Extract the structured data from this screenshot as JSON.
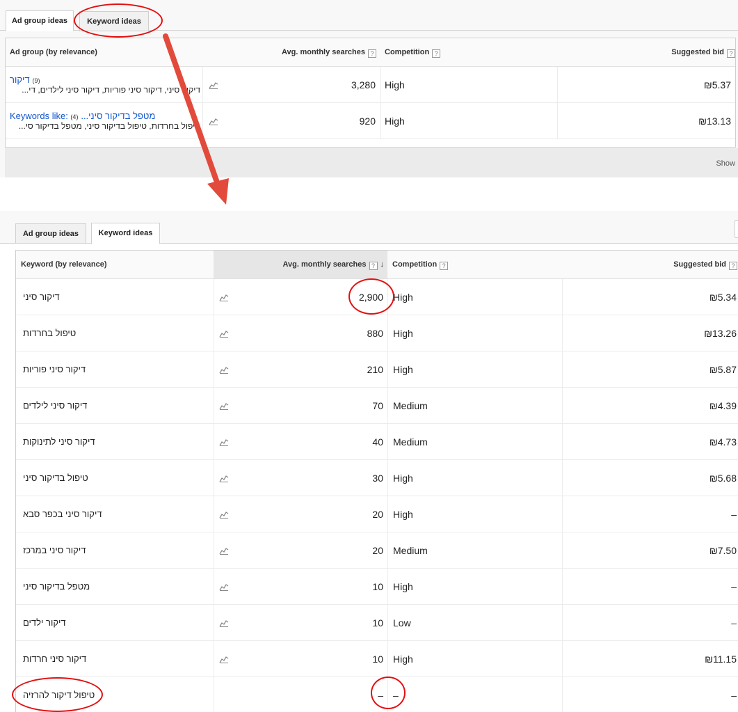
{
  "top_panel": {
    "tabs": [
      {
        "label": "Ad group ideas",
        "active": true
      },
      {
        "label": "Keyword ideas",
        "active": false
      }
    ],
    "columns": {
      "group": "Ad group (by relevance)",
      "searches": "Avg. monthly searches",
      "competition": "Competition",
      "bid": "Suggested bid"
    },
    "help_glyph": "?",
    "rows": [
      {
        "name": "דיקור",
        "count": "(9)",
        "keywords": "דיקור סיני, דיקור סיני פוריות, דיקור סיני לילדים, די...",
        "searches": "3,280",
        "competition": "High",
        "bid": "₪5.37"
      },
      {
        "name": "Keywords like: מטפל בדיקור סיני...",
        "count": "(4)",
        "keywords": "טיפול בחרדות, טיפול בדיקור סיני, מטפל בדיקור סי...",
        "searches": "920",
        "competition": "High",
        "bid": "₪13.13"
      }
    ],
    "footer_text": "Show"
  },
  "bottom_panel": {
    "tabs": [
      {
        "label": "Ad group ideas",
        "active": false
      },
      {
        "label": "Keyword ideas",
        "active": true
      }
    ],
    "columns": {
      "keyword": "Keyword (by relevance)",
      "searches": "Avg. monthly searches",
      "competition": "Competition",
      "bid": "Suggested bid"
    },
    "sort_glyph": "↓",
    "rows": [
      {
        "keyword": "דיקור סיני",
        "searches": "2,900",
        "competition": "High",
        "bid": "₪5.34",
        "trend": true
      },
      {
        "keyword": "טיפול בחרדות",
        "searches": "880",
        "competition": "High",
        "bid": "₪13.26",
        "trend": true
      },
      {
        "keyword": "דיקור סיני פוריות",
        "searches": "210",
        "competition": "High",
        "bid": "₪5.87",
        "trend": true
      },
      {
        "keyword": "דיקור סיני לילדים",
        "searches": "70",
        "competition": "Medium",
        "bid": "₪4.39",
        "trend": true
      },
      {
        "keyword": "דיקור סיני לתינוקות",
        "searches": "40",
        "competition": "Medium",
        "bid": "₪4.73",
        "trend": true
      },
      {
        "keyword": "טיפול בדיקור סיני",
        "searches": "30",
        "competition": "High",
        "bid": "₪5.68",
        "trend": true
      },
      {
        "keyword": "דיקור סיני בכפר סבא",
        "searches": "20",
        "competition": "High",
        "bid": "–",
        "trend": true
      },
      {
        "keyword": "דיקור סיני במרכז",
        "searches": "20",
        "competition": "Medium",
        "bid": "₪7.50",
        "trend": true
      },
      {
        "keyword": "מטפל בדיקור סיני",
        "searches": "10",
        "competition": "High",
        "bid": "–",
        "trend": true
      },
      {
        "keyword": "דיקור ילדים",
        "searches": "10",
        "competition": "Low",
        "bid": "–",
        "trend": true
      },
      {
        "keyword": "דיקור סיני חרדות",
        "searches": "10",
        "competition": "High",
        "bid": "₪11.15",
        "trend": true
      },
      {
        "keyword": "טיפול דיקור להרזיה",
        "searches": "–",
        "competition": "–",
        "bid": "–",
        "trend": false
      }
    ]
  },
  "annotation_color": "#e31010",
  "link_color": "#1155cc"
}
